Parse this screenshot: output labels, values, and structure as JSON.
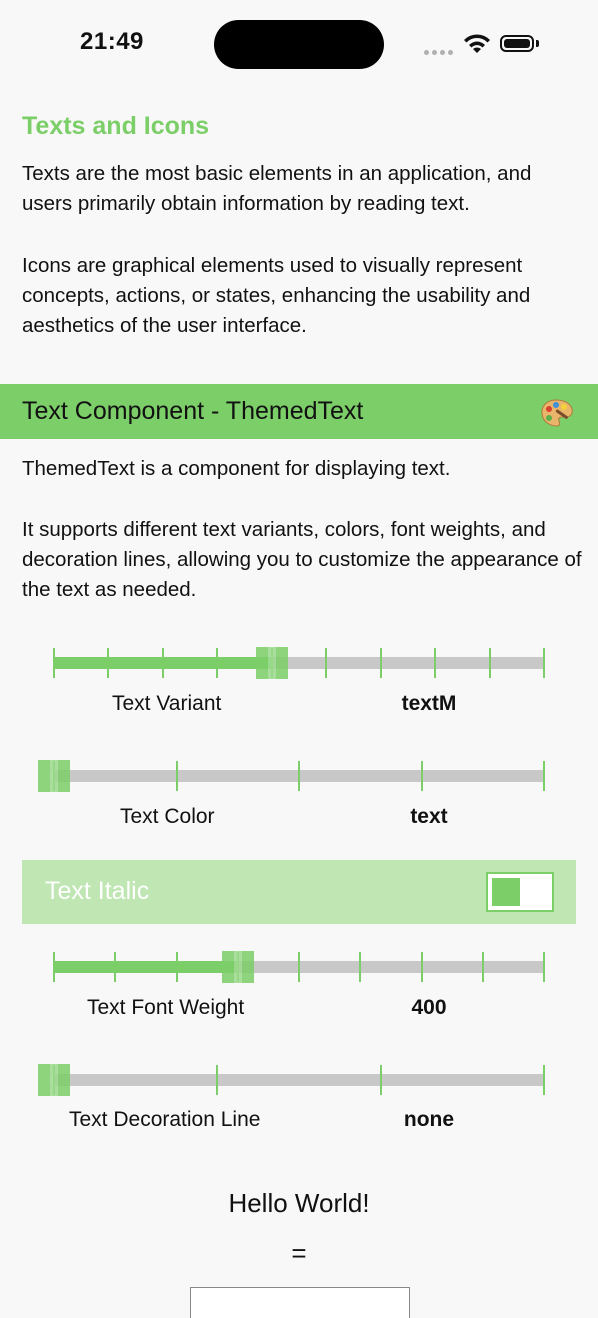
{
  "status_bar": {
    "time": "21:49"
  },
  "section": {
    "title": "Texts and Icons",
    "paragraph1": "Texts are the most basic elements in an application, and users primarily obtain information by reading text.",
    "paragraph2": "Icons are graphical elements used to visually represent concepts, actions, or states, enhancing the usability and aesthetics of the user interface."
  },
  "component": {
    "title": "Text Component - ThemedText",
    "icon": "palette-icon",
    "desc1": "ThemedText is a component for displaying text.",
    "desc2": "It supports different text variants, colors, font weights, and decoration lines, allowing you to customize the appearance of the text as needed."
  },
  "controls": {
    "variant": {
      "label": "Text Variant",
      "value": "textM",
      "ticks": 10,
      "selected_index": 4
    },
    "color": {
      "label": "Text Color",
      "value": "text",
      "ticks": 5,
      "selected_index": 0
    },
    "italic": {
      "label": "Text Italic",
      "on": false
    },
    "weight": {
      "label": "Text Font Weight",
      "value": "400",
      "ticks": 9,
      "selected_index": 3
    },
    "decoration": {
      "label": "Text Decoration Line",
      "value": "none",
      "ticks": 4,
      "selected_index": 0
    }
  },
  "preview": {
    "text": "Hello World!",
    "equals": "="
  },
  "colors": {
    "accent": "#7cce68",
    "track": "#c8c8c8",
    "italic_row": "#bfe6b3",
    "background": "#f8f8f8"
  }
}
